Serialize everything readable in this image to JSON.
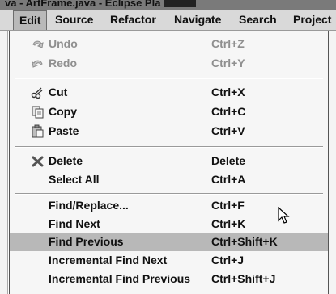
{
  "window": {
    "title": "va - ArtFrame.java - Eclipse Pla"
  },
  "menubar": {
    "items": [
      "Edit",
      "Source",
      "Refactor",
      "Navigate",
      "Search",
      "Project"
    ]
  },
  "edit_menu": {
    "undo": {
      "label": "Undo",
      "accel": "Ctrl+Z",
      "icon": "undo-icon"
    },
    "redo": {
      "label": "Redo",
      "accel": "Ctrl+Y",
      "icon": "redo-icon"
    },
    "cut": {
      "label": "Cut",
      "accel": "Ctrl+X",
      "icon": "scissors-icon"
    },
    "copy": {
      "label": "Copy",
      "accel": "Ctrl+C",
      "icon": "copy-icon"
    },
    "paste": {
      "label": "Paste",
      "accel": "Ctrl+V",
      "icon": "paste-icon"
    },
    "delete": {
      "label": "Delete",
      "accel": "Delete",
      "icon": "delete-x-icon"
    },
    "select_all": {
      "label": "Select All",
      "accel": "Ctrl+A"
    },
    "find_replace": {
      "label": "Find/Replace...",
      "accel": "Ctrl+F"
    },
    "find_next": {
      "label": "Find Next",
      "accel": "Ctrl+K"
    },
    "find_previous": {
      "label": "Find Previous",
      "accel": "Ctrl+Shift+K"
    },
    "incremental_next": {
      "label": "Incremental Find Next",
      "accel": "Ctrl+J"
    },
    "incremental_previous": {
      "label": "Incremental Find Previous",
      "accel": "Ctrl+Shift+J"
    }
  },
  "colors": {
    "highlight": "#b8b8b8",
    "menu_bg": "#f6f6f6",
    "disabled_text": "#8f8f8f"
  }
}
